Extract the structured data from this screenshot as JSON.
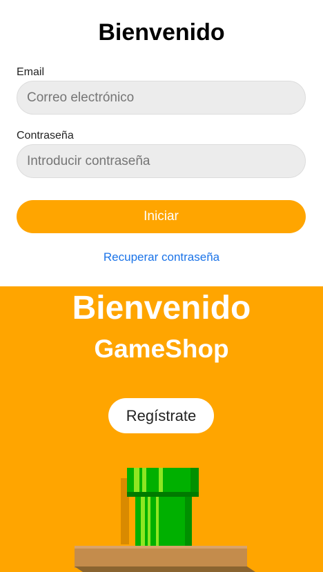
{
  "login": {
    "title": "Bienvenido",
    "email_label": "Email",
    "email_placeholder": "Correo electrónico",
    "password_label": "Contraseña",
    "password_placeholder": "Introducir contraseña",
    "submit_label": "Iniciar",
    "recover_label": "Recuperar contraseña"
  },
  "promo": {
    "title": "Bienvenido",
    "subtitle": "GameShop",
    "register_label": "Regístrate"
  },
  "colors": {
    "accent": "#ffa500",
    "link": "#1a73e8",
    "pipe_green": "#00b000",
    "pipe_highlight": "#8ee622",
    "platform": "#c48c4c"
  },
  "icons": {
    "illustration": "green-pipe-illustration"
  }
}
